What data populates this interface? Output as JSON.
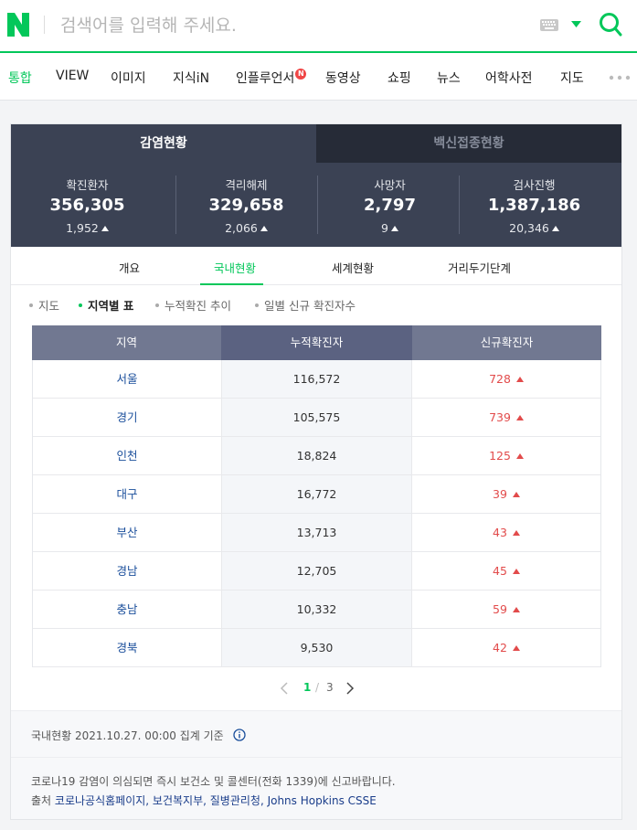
{
  "search": {
    "placeholder": "검색어를 입력해 주세요."
  },
  "tabs": [
    {
      "label": "통합",
      "active": true
    },
    {
      "label": "VIEW"
    },
    {
      "label": "이미지"
    },
    {
      "label": "지식iN"
    },
    {
      "label": "인플루언서",
      "badge": "N"
    },
    {
      "label": "동영상"
    },
    {
      "label": "쇼핑"
    },
    {
      "label": "뉴스"
    },
    {
      "label": "어학사전"
    },
    {
      "label": "지도"
    }
  ],
  "main_tabs": [
    {
      "label": "감염현황",
      "active": true
    },
    {
      "label": "백신접종현황"
    }
  ],
  "stats": [
    {
      "label": "확진환자",
      "value": "356,305",
      "change": "1,952"
    },
    {
      "label": "격리해제",
      "value": "329,658",
      "change": "2,066"
    },
    {
      "label": "사망자",
      "value": "2,797",
      "change": "9"
    },
    {
      "label": "검사진행",
      "value": "1,387,186",
      "change": "20,346"
    }
  ],
  "sub_tabs": [
    {
      "label": "개요"
    },
    {
      "label": "국내현황",
      "active": true
    },
    {
      "label": "세계현황"
    },
    {
      "label": "거리두기단계"
    }
  ],
  "filters": [
    {
      "label": "지도"
    },
    {
      "label": "지역별 표",
      "active": true
    },
    {
      "label": "누적확진 추이"
    },
    {
      "label": "일별 신규 확진자수"
    }
  ],
  "table": {
    "headers": [
      "지역",
      "누적확진자",
      "신규확진자"
    ],
    "rows": [
      {
        "region": "서울",
        "total": "116,572",
        "new": "728"
      },
      {
        "region": "경기",
        "total": "105,575",
        "new": "739"
      },
      {
        "region": "인천",
        "total": "18,824",
        "new": "125"
      },
      {
        "region": "대구",
        "total": "16,772",
        "new": "39"
      },
      {
        "region": "부산",
        "total": "13,713",
        "new": "43"
      },
      {
        "region": "경남",
        "total": "12,705",
        "new": "45"
      },
      {
        "region": "충남",
        "total": "10,332",
        "new": "59"
      },
      {
        "region": "경북",
        "total": "9,530",
        "new": "42"
      }
    ]
  },
  "pager": {
    "current": "1",
    "separator": "/",
    "total": "3"
  },
  "info": {
    "updated": "국내현황 2021.10.27. 00:00 집계 기준",
    "notice": "코로나19 감염이 의심되면 즉시 보건소 및 콜센터(전화 1339)에 신고바랍니다.",
    "source_prefix": "출처",
    "sources": "코로나공식홈페이지, 보건복지부, 질병관리청, Johns Hopkins CSSE"
  },
  "colors": {
    "brand_green": "#03c75a",
    "panel_dark": "#3b4254",
    "increase_red": "#e24b4b"
  }
}
